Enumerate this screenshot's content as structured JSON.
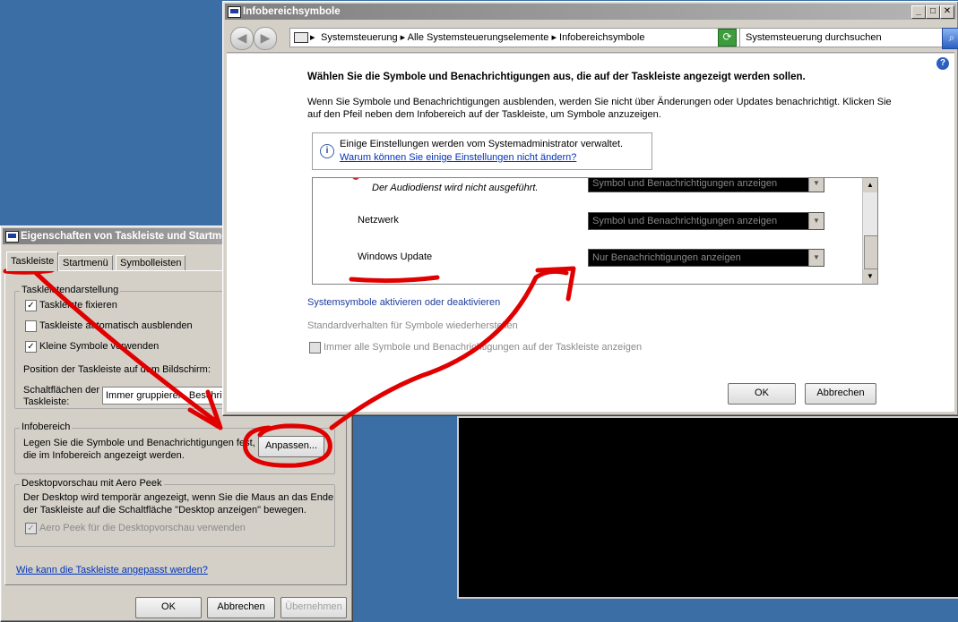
{
  "infobereich_window": {
    "title": "Infobereichsymbole",
    "nav": {
      "address_parts": [
        "Systemsteuerung",
        "Alle Systemsteuerungselemente",
        "Infobereichsymbole"
      ],
      "search_placeholder": "Systemsteuerung durchsuchen"
    },
    "heading": "Wählen Sie die Symbole und Benachrichtigungen aus, die auf der Taskleiste angezeigt werden sollen.",
    "description_line1": "Wenn Sie Symbole und Benachrichtigungen ausblenden, werden Sie nicht über Änderungen oder Updates benachrichtigt. Klicken Sie",
    "description_line2": "auf den Pfeil neben dem Infobereich auf der Taskleiste, um Symbole anzuzeigen.",
    "admin_notice": "Einige Einstellungen werden vom Systemadministrator verwaltet.",
    "admin_link": "Warum können Sie einige Einstellungen nicht ändern?",
    "icon_rows": [
      {
        "name": "Der Audiodienst wird nicht ausgeführt.",
        "behavior": "Symbol und Benachrichtigungen anzeigen"
      },
      {
        "name": "Netzwerk",
        "behavior": "Symbol und Benachrichtigungen anzeigen"
      },
      {
        "name": "Windows Update",
        "behavior": "Nur Benachrichtigungen anzeigen"
      }
    ],
    "link_system_icons": "Systemsymbole aktivieren oder deaktivieren",
    "link_restore_default": "Standardverhalten für Symbole wiederherstellen",
    "always_show_label": "Immer alle Symbole und Benachrichtigungen auf der Taskleiste anzeigen",
    "ok_label": "OK",
    "cancel_label": "Abbrechen",
    "help_glyph": "?"
  },
  "taskbar_window": {
    "title": "Eigenschaften von Taskleiste und Startmenü",
    "tabs": [
      "Taskleiste",
      "Startmenü",
      "Symbolleisten"
    ],
    "group_appearance": "Taskleistendarstellung",
    "chk_lock": {
      "label": "Taskleiste fixieren",
      "checked": true
    },
    "chk_autohide": {
      "label": "Taskleiste automatisch ausblenden",
      "checked": false
    },
    "chk_small": {
      "label": "Kleine Symbole verwenden",
      "checked": true
    },
    "position_label": "Position der Taskleiste auf dem Bildschirm:",
    "buttons_label_1": "Schaltflächen der",
    "buttons_label_2": "Taskleiste:",
    "buttons_value": "Immer gruppieren, Beschriftungen ausblenden",
    "group_notify": "Infobereich",
    "notify_text_1": "Legen Sie die Symbole und Benachrichtigungen fest,",
    "notify_text_2": "die im Infobereich angezeigt werden.",
    "customize_label": "Anpassen...",
    "group_peek": "Desktopvorschau mit Aero Peek",
    "peek_text_1": "Der Desktop wird temporär angezeigt, wenn Sie die Maus an das Ende",
    "peek_text_2": "der Taskleiste auf die Schaltfläche \"Desktop anzeigen\" bewegen.",
    "chk_peek": {
      "label": "Aero Peek für die Desktopvorschau verwenden",
      "checked": true
    },
    "help_link": "Wie kann die Taskleiste angepasst werden?",
    "ok_label": "OK",
    "cancel_label": "Abbrechen",
    "apply_label": "Übernehmen"
  },
  "colors": {
    "desktop": "#3a6ea5",
    "annotation_red": "#e00000"
  }
}
